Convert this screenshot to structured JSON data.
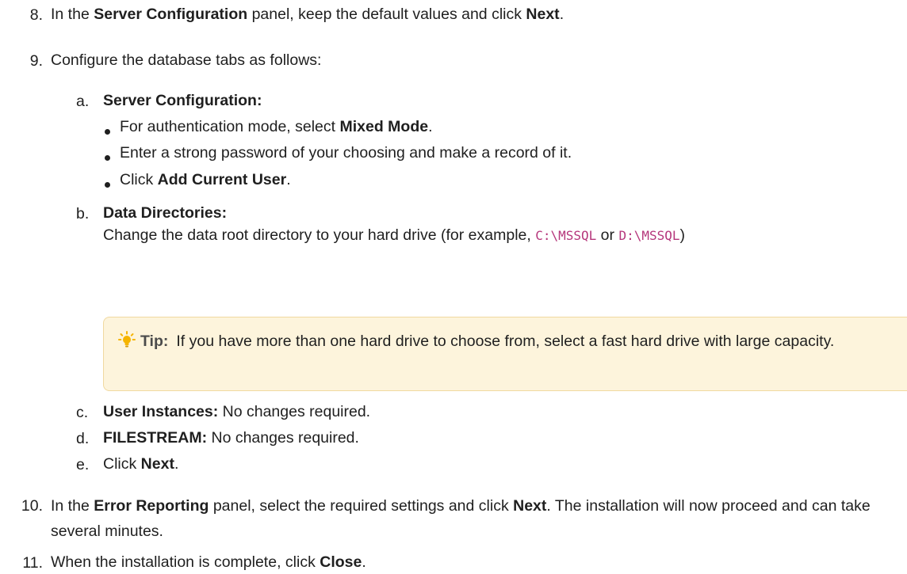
{
  "steps": {
    "s8": {
      "num": "8.",
      "pre": "In the ",
      "b1": "Server Configuration",
      "mid": " panel, keep the default values and click ",
      "b2": "Next",
      "post": "."
    },
    "s9": {
      "num": "9.",
      "text": "Configure the database tabs as follows:",
      "a": {
        "letter": "a.",
        "title": "Server Configuration:",
        "bullets": {
          "b1": {
            "pre": "For authentication mode, select ",
            "bold": "Mixed Mode",
            "post": "."
          },
          "b2": {
            "text": "Enter a strong password of your choosing and make a record of it."
          },
          "b3": {
            "pre": "Click ",
            "bold": "Add Current User",
            "post": "."
          }
        }
      },
      "b": {
        "letter": "b.",
        "title": "Data Directories:",
        "desc_pre": "Change the data root directory to your hard drive (for example, ",
        "code1": "C:\\MSSQL",
        "or": " or ",
        "code2": "D:\\MSSQL",
        "desc_post": ")",
        "tip": {
          "label": "Tip:",
          "text": "If you have more than one hard drive to choose from, select a fast hard drive with large capacity."
        }
      },
      "c": {
        "letter": "c.",
        "title": "User Instances:",
        "text": " No changes required."
      },
      "d": {
        "letter": "d.",
        "title": "FILESTREAM:",
        "text": " No changes required."
      },
      "e": {
        "letter": "e.",
        "pre": "Click ",
        "bold": "Next",
        "post": "."
      }
    },
    "s10": {
      "num": "10.",
      "pre": "In the ",
      "b1": "Error Reporting",
      "mid": " panel, select the required settings and click ",
      "b2": "Next",
      "post": ". The installation will now proceed and can take several minutes."
    },
    "s11": {
      "num": "11.",
      "pre": "When the installation is complete, click ",
      "b1": "Close",
      "post": "."
    }
  },
  "colors": {
    "text": "#1f1f1f",
    "code": "#b5367b",
    "tip_bg": "#fdf4dc",
    "tip_border": "#f0d9a0",
    "tip_icon": "#f5b400"
  },
  "icons": {
    "tip": "lightbulb-icon"
  }
}
